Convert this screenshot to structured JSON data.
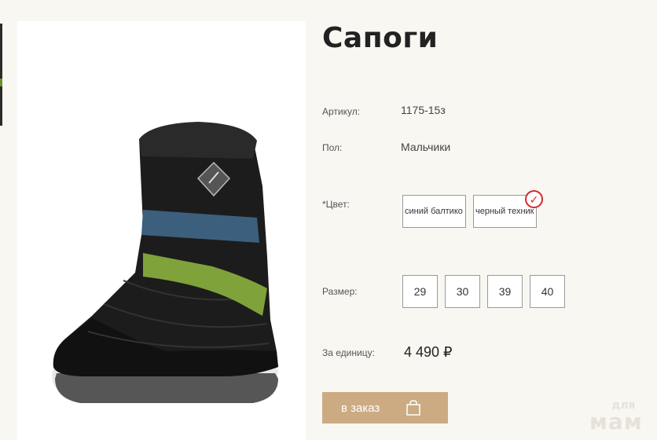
{
  "product": {
    "title": "Сапоги",
    "article_label": "Артикул:",
    "article_value": "1175-15з",
    "gender_label": "Пол:",
    "gender_value": "Мальчики",
    "color_label": "*Цвет:",
    "colors": [
      {
        "label": "синий балтико",
        "selected": false
      },
      {
        "label": "черный техник",
        "selected": true
      }
    ],
    "size_label": "Размер:",
    "sizes": [
      "29",
      "30",
      "39",
      "40"
    ],
    "unit_price_label": "За единицу:",
    "price": "4 490 ₽",
    "order_button_label": "в заказ"
  },
  "watermark": {
    "line1": "для",
    "line2": "мам"
  },
  "colors": {
    "background": "#f9f7f2",
    "button": "#ccab83",
    "check": "#d9262b",
    "boot_stripe_blue": "#3c5f7d",
    "boot_stripe_green": "#7fa23a"
  },
  "icons": {
    "selected_mark": "check-circle-icon",
    "cart": "shopping-bag-icon"
  }
}
